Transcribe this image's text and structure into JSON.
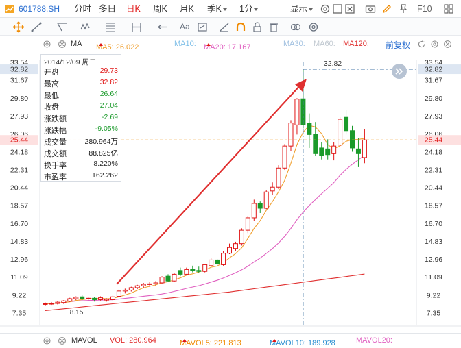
{
  "topbar": {
    "symbol": "601788.SH",
    "tabs": [
      "分时",
      "多日",
      "日K",
      "周K",
      "月K",
      "季K",
      "1分"
    ],
    "active_tab": "日K",
    "display_label": "显示",
    "right_label": "F10"
  },
  "toolbar": {
    "text_tool": "Aa"
  },
  "ma_line": {
    "indicator": "MA",
    "ma5_label": "MA5: 26.022",
    "ma10_label": "MA10:",
    "ma20_label": "MA20: 17.167",
    "ma30_label": "MA30:",
    "ma60_label": "MA60:",
    "ma120_label": "MA120:",
    "adjust_label": "前复权"
  },
  "colors": {
    "up": "#e01515",
    "down": "#1a9a2a",
    "ma5": "#f0a030",
    "ma10": "#80c0e8",
    "ma20": "#e060c0",
    "ma30": "#a0c0e0",
    "ma60": "#c0c8d0",
    "ma120": "#e03030",
    "price_line": "#f0a030",
    "crosshair": "#4a7aa8"
  },
  "info_panel": {
    "date": "2014/12/09 周二",
    "rows": [
      {
        "k": "开盘",
        "v": "29.73",
        "c": "red"
      },
      {
        "k": "最高",
        "v": "32.82",
        "c": "red"
      },
      {
        "k": "最低",
        "v": "26.64",
        "c": "green"
      },
      {
        "k": "收盘",
        "v": "27.04",
        "c": "green"
      },
      {
        "k": "涨跌额",
        "v": "-2.69",
        "c": "green"
      },
      {
        "k": "涨跌幅",
        "v": "-9.05%",
        "c": "green"
      },
      {
        "k": "成交量",
        "v": "280.964万",
        "c": "black"
      },
      {
        "k": "成交额",
        "v": "88.825亿",
        "c": "black"
      },
      {
        "k": "换手率",
        "v": "8.220%",
        "c": "black"
      },
      {
        "k": "市盈率",
        "v": "162.262",
        "c": "black"
      }
    ]
  },
  "chart_data": {
    "type": "candlestick",
    "y_axis_ticks": [
      "33.54",
      "32.82",
      "31.67",
      "29.80",
      "27.93",
      "26.06",
      "25.44",
      "24.18",
      "22.31",
      "20.44",
      "18.57",
      "16.70",
      "14.83",
      "12.96",
      "11.09",
      "9.22",
      "7.35"
    ],
    "y_axis_tick_values": [
      33.54,
      32.82,
      31.67,
      29.8,
      27.93,
      26.06,
      25.44,
      24.18,
      22.31,
      20.44,
      18.57,
      16.7,
      14.83,
      12.96,
      11.09,
      9.22,
      7.35
    ],
    "highlight_high": "32.82",
    "highlight_price": "25.44",
    "high_label": "32.82",
    "low_label": "8.15",
    "ylim": [
      7.35,
      33.54
    ],
    "candles": [
      {
        "o": 8.25,
        "h": 8.45,
        "l": 8.15,
        "c": 8.32
      },
      {
        "o": 8.32,
        "h": 8.5,
        "l": 8.2,
        "c": 8.35
      },
      {
        "o": 8.35,
        "h": 8.6,
        "l": 8.25,
        "c": 8.48
      },
      {
        "o": 8.45,
        "h": 8.7,
        "l": 8.3,
        "c": 8.62
      },
      {
        "o": 8.6,
        "h": 8.95,
        "l": 8.5,
        "c": 8.85
      },
      {
        "o": 8.85,
        "h": 9.1,
        "l": 8.7,
        "c": 9.0
      },
      {
        "o": 9.05,
        "h": 9.2,
        "l": 8.7,
        "c": 8.82
      },
      {
        "o": 8.85,
        "h": 9.0,
        "l": 8.7,
        "c": 8.9
      },
      {
        "o": 8.9,
        "h": 9.0,
        "l": 8.55,
        "c": 8.75
      },
      {
        "o": 8.75,
        "h": 9.1,
        "l": 8.65,
        "c": 8.95
      },
      {
        "o": 8.7,
        "h": 8.9,
        "l": 8.55,
        "c": 8.8
      },
      {
        "o": 8.75,
        "h": 9.2,
        "l": 8.6,
        "c": 9.05
      },
      {
        "o": 9.1,
        "h": 9.8,
        "l": 9.0,
        "c": 9.65
      },
      {
        "o": 9.65,
        "h": 9.9,
        "l": 9.4,
        "c": 9.75
      },
      {
        "o": 9.75,
        "h": 10.1,
        "l": 9.6,
        "c": 10.0
      },
      {
        "o": 10.0,
        "h": 10.3,
        "l": 9.85,
        "c": 10.2
      },
      {
        "o": 10.2,
        "h": 10.5,
        "l": 10.0,
        "c": 10.35
      },
      {
        "o": 10.35,
        "h": 10.6,
        "l": 10.1,
        "c": 10.4
      },
      {
        "o": 10.4,
        "h": 10.7,
        "l": 10.2,
        "c": 10.5
      },
      {
        "o": 10.5,
        "h": 11.2,
        "l": 10.4,
        "c": 11.1
      },
      {
        "o": 11.2,
        "h": 11.4,
        "l": 10.6,
        "c": 10.7
      },
      {
        "o": 10.7,
        "h": 11.5,
        "l": 10.6,
        "c": 11.4
      },
      {
        "o": 11.8,
        "h": 12.1,
        "l": 11.2,
        "c": 11.4
      },
      {
        "o": 11.4,
        "h": 12.1,
        "l": 11.3,
        "c": 11.9
      },
      {
        "o": 11.9,
        "h": 12.3,
        "l": 11.6,
        "c": 11.8
      },
      {
        "o": 11.8,
        "h": 12.2,
        "l": 11.5,
        "c": 11.7
      },
      {
        "o": 11.7,
        "h": 12.5,
        "l": 11.6,
        "c": 12.4
      },
      {
        "o": 12.3,
        "h": 13.1,
        "l": 12.2,
        "c": 12.9
      },
      {
        "o": 12.9,
        "h": 13.0,
        "l": 12.3,
        "c": 12.5
      },
      {
        "o": 12.4,
        "h": 13.8,
        "l": 12.3,
        "c": 13.6
      },
      {
        "o": 13.6,
        "h": 14.6,
        "l": 13.5,
        "c": 14.2
      },
      {
        "o": 14.1,
        "h": 14.8,
        "l": 13.8,
        "c": 14.6
      },
      {
        "o": 14.6,
        "h": 16.2,
        "l": 14.4,
        "c": 16.0
      },
      {
        "o": 16.0,
        "h": 17.5,
        "l": 15.7,
        "c": 17.3
      },
      {
        "o": 17.3,
        "h": 19.2,
        "l": 17.0,
        "c": 18.8
      },
      {
        "o": 18.8,
        "h": 19.0,
        "l": 17.8,
        "c": 18.3
      },
      {
        "o": 18.3,
        "h": 20.2,
        "l": 18.2,
        "c": 20.0
      },
      {
        "o": 20.1,
        "h": 21.0,
        "l": 19.7,
        "c": 20.5
      },
      {
        "o": 20.5,
        "h": 22.8,
        "l": 20.3,
        "c": 22.5
      },
      {
        "o": 22.5,
        "h": 25.0,
        "l": 22.3,
        "c": 24.8
      },
      {
        "o": 24.8,
        "h": 27.5,
        "l": 24.3,
        "c": 27.2
      },
      {
        "o": 27.0,
        "h": 29.8,
        "l": 26.0,
        "c": 29.7
      },
      {
        "o": 29.73,
        "h": 32.82,
        "l": 26.64,
        "c": 27.04
      },
      {
        "o": 27.2,
        "h": 28.2,
        "l": 24.6,
        "c": 26.0
      },
      {
        "o": 26.0,
        "h": 27.3,
        "l": 23.8,
        "c": 24.0
      },
      {
        "o": 24.6,
        "h": 25.2,
        "l": 23.4,
        "c": 23.8
      },
      {
        "o": 24.5,
        "h": 25.5,
        "l": 23.4,
        "c": 23.9
      },
      {
        "o": 24.0,
        "h": 25.2,
        "l": 23.3,
        "c": 24.8
      },
      {
        "o": 24.9,
        "h": 27.8,
        "l": 24.8,
        "c": 27.6
      },
      {
        "o": 27.8,
        "h": 28.6,
        "l": 26.0,
        "c": 26.4
      },
      {
        "o": 26.4,
        "h": 26.9,
        "l": 24.2,
        "c": 24.6
      },
      {
        "o": 24.5,
        "h": 25.6,
        "l": 22.6,
        "c": 24.0
      },
      {
        "o": 23.6,
        "h": 26.6,
        "l": 23.0,
        "c": 25.44
      }
    ]
  },
  "bottombar": {
    "indicator": "MAVOL",
    "vol": "VOL: 280.964",
    "mavol5": "MAVOL5: 221.813",
    "mavol10": "MAVOL10: 189.928",
    "mavol20": "MAVOL20:"
  }
}
